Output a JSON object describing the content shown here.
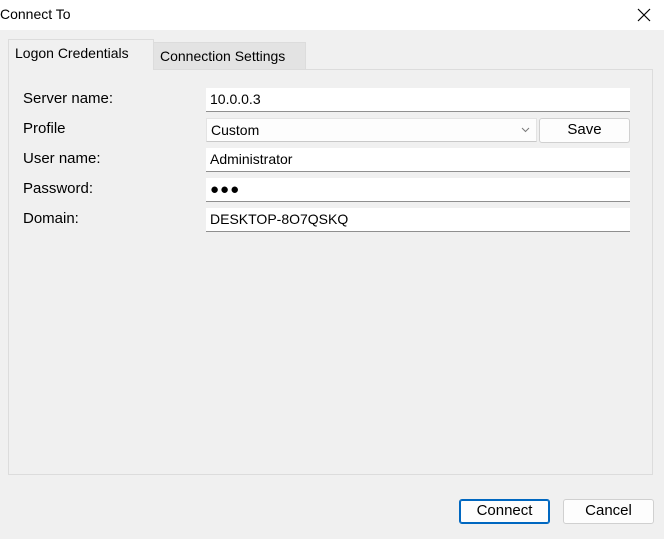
{
  "window": {
    "title": "Connect To"
  },
  "tabs": [
    {
      "label": "Logon Credentials",
      "active": true
    },
    {
      "label": "Connection Settings",
      "active": false
    }
  ],
  "form": {
    "server_label": "Server name:",
    "server_value": "10.0.0.3",
    "profile_label": "Profile",
    "profile_value": "Custom",
    "save_label": "Save",
    "user_label": "User name:",
    "user_value": "Administrator",
    "password_label": "Password:",
    "password_mask": "●●●",
    "domain_label": "Domain:",
    "domain_value": "DESKTOP-8O7QSKQ"
  },
  "footer": {
    "connect_label": "Connect",
    "cancel_label": "Cancel"
  },
  "colors": {
    "background": "#f0f0f0",
    "accent": "#0067c0",
    "field_bg": "#ffffff"
  },
  "icons": {
    "close": "close-icon",
    "dropdown": "chevron-down-icon"
  }
}
